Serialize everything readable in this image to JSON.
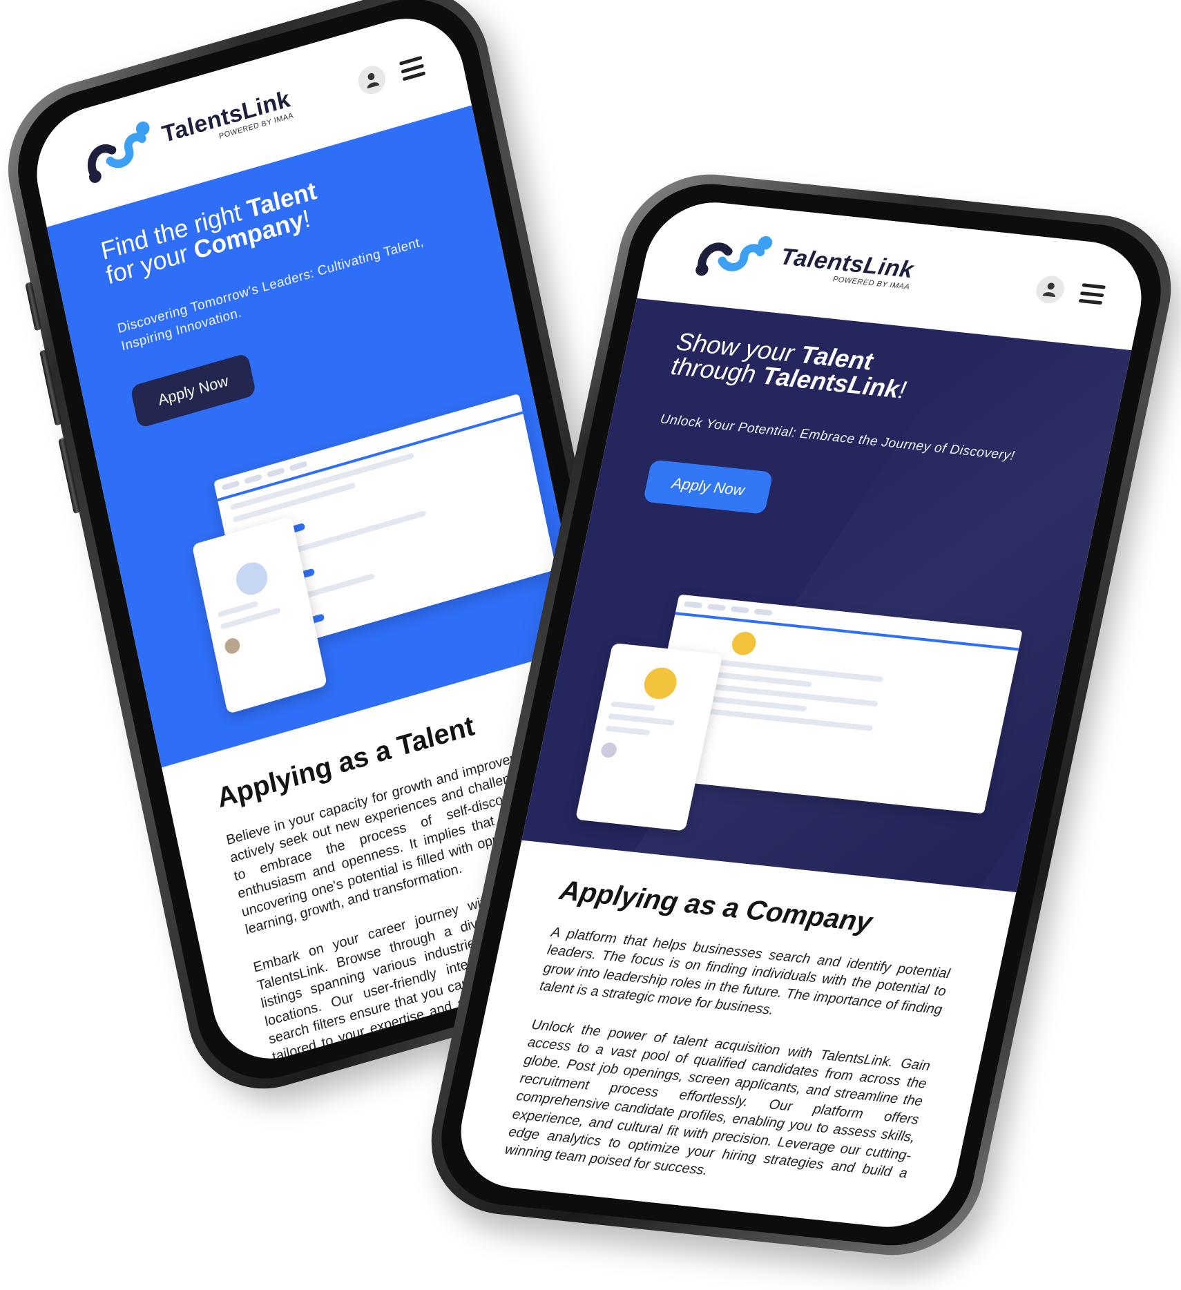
{
  "brand": {
    "name": "TalentsLink",
    "tagline": "POWERED BY IMAA",
    "colors": {
      "blue": "#2f6ef6",
      "navy": "#25265e",
      "dark_button": "#23264e",
      "bright_button": "#3277f5"
    }
  },
  "icons": {
    "user": "user-icon",
    "menu": "hamburger-menu-icon"
  },
  "phone_talent": {
    "hero": {
      "title_part1": "Find the right ",
      "title_bold1": "Talent",
      "title_part2": "for your ",
      "title_bold2": "Company",
      "title_end": "!",
      "tagline": "Discovering Tomorrow's Leaders: Cultivating Talent, Inspiring Innovation.",
      "button": "Apply Now"
    },
    "section": {
      "title": "Applying as a Talent",
      "paragraphs": [
        "Believe in your capacity for growth and improvement, to actively seek out new experiences and challenges, and to embrace the process of self-discovery with enthusiasm and openness. It implies that the path to uncovering one's potential is filled with opportunities for learning, growth, and transformation.",
        "Embark on your career journey with confidence at TalentsLink. Browse through a diverse array of job listings spanning various industries, skill levels, and locations. Our user-friendly interface and advanced search filters ensure that you can pinpoint opportunities tailored to your expertise and aspirations. Upload your resume, showcase your skills, and let your achievements shine bright. With instant alerts and personalized recommendations, finding your dream job has never been easier."
      ]
    }
  },
  "phone_company": {
    "hero": {
      "title_part1": "Show your ",
      "title_bold1": "Talent",
      "title_part2": "through ",
      "title_bold2": "TalentsLink",
      "title_end": "!",
      "tagline": "Unlock Your Potential: Embrace the Journey of Discovery!",
      "button": "Apply Now"
    },
    "section": {
      "title": "Applying as a Company",
      "paragraphs": [
        "A platform that helps businesses search and identify potential leaders. The focus is on finding individuals with the potential to grow into leadership roles in the future. The importance of finding talent is a strategic move for business.",
        "Unlock the power of talent acquisition with TalentsLink. Gain access to a vast pool of qualified candidates from across the globe. Post job openings, screen applicants, and streamline the recruitment process effortlessly. Our platform offers comprehensive candidate profiles, enabling you to assess skills, experience, and cultural fit with precision. Leverage our cutting-edge analytics to optimize your hiring strategies and build a winning team poised for success."
      ]
    }
  }
}
